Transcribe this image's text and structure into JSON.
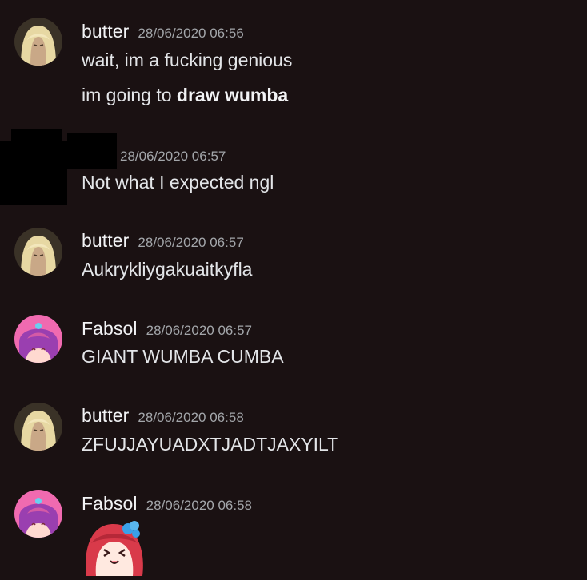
{
  "messages": [
    {
      "username": "butter",
      "timestamp": "28/06/2020 06:56",
      "lines": [
        {
          "text": "wait, im a fucking genious"
        },
        {
          "prefix": "im going to ",
          "bold": "draw wumba"
        }
      ]
    },
    {
      "username": "",
      "timestamp": "28/06/2020 06:57",
      "lines": [
        {
          "text": "Not what I expected ngl"
        }
      ]
    },
    {
      "username": "butter",
      "timestamp": "28/06/2020 06:57",
      "lines": [
        {
          "text": "Aukrykliygakuaitkyfla"
        }
      ]
    },
    {
      "username": "Fabsol",
      "timestamp": "28/06/2020 06:57",
      "lines": [
        {
          "text": "GIANT WUMBA CUMBA"
        }
      ]
    },
    {
      "username": "butter",
      "timestamp": "28/06/2020 06:58",
      "lines": [
        {
          "text": "ZFUJJAYUADXTJADTJAXYILT"
        }
      ]
    },
    {
      "username": "Fabsol",
      "timestamp": "28/06/2020 06:58",
      "lines": [],
      "emoji": "happy-anime-girl-emoji"
    }
  ],
  "colors": {
    "background": "#1a1112",
    "username": "#f2f3f5",
    "timestamp": "#a3a6aa",
    "text": "#e3e5e8"
  }
}
